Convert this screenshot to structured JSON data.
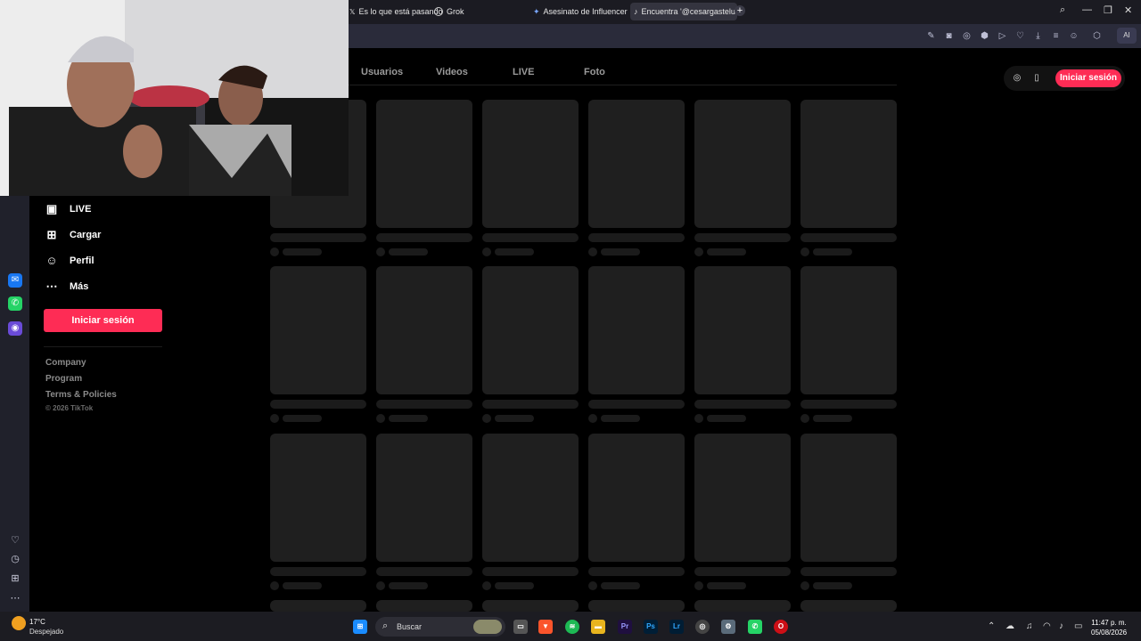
{
  "browser": {
    "tabs": [
      {
        "label": "Es lo que está pasando",
        "icon": "x-icon"
      },
      {
        "label": "Grok",
        "icon": "grok-icon"
      },
      {
        "label": "Asesinato de Influencer e",
        "icon": "sparkle-icon"
      },
      {
        "label": "Encuentra '@cesargastelu",
        "icon": "tiktok-icon",
        "active": true
      }
    ],
    "new_tab": "+",
    "ai_button": "AI"
  },
  "tiktok": {
    "search_tabs": [
      "Usuarios",
      "Videos",
      "LIVE",
      "Foto"
    ],
    "nav": [
      {
        "label": "LIVE",
        "icon": "live-icon"
      },
      {
        "label": "Cargar",
        "icon": "upload-icon"
      },
      {
        "label": "Perfil",
        "icon": "profile-icon"
      },
      {
        "label": "Más",
        "icon": "more-icon"
      }
    ],
    "login_side": "Iniciar sesión",
    "login_top": "Iniciar sesión",
    "footer": [
      "Company",
      "Program",
      "Terms & Policies"
    ],
    "copyright": "© 2026 TikTok"
  },
  "taskbar": {
    "temperature": "17°C",
    "weather": "Despejado",
    "search_placeholder": "Buscar",
    "time": "11:47 p. m.",
    "date": "05/08/2026",
    "apps": [
      "Pr",
      "Ps",
      "Lr"
    ]
  },
  "colors": {
    "accent": "#fe2c55",
    "skeleton": "#1f1f1f"
  }
}
